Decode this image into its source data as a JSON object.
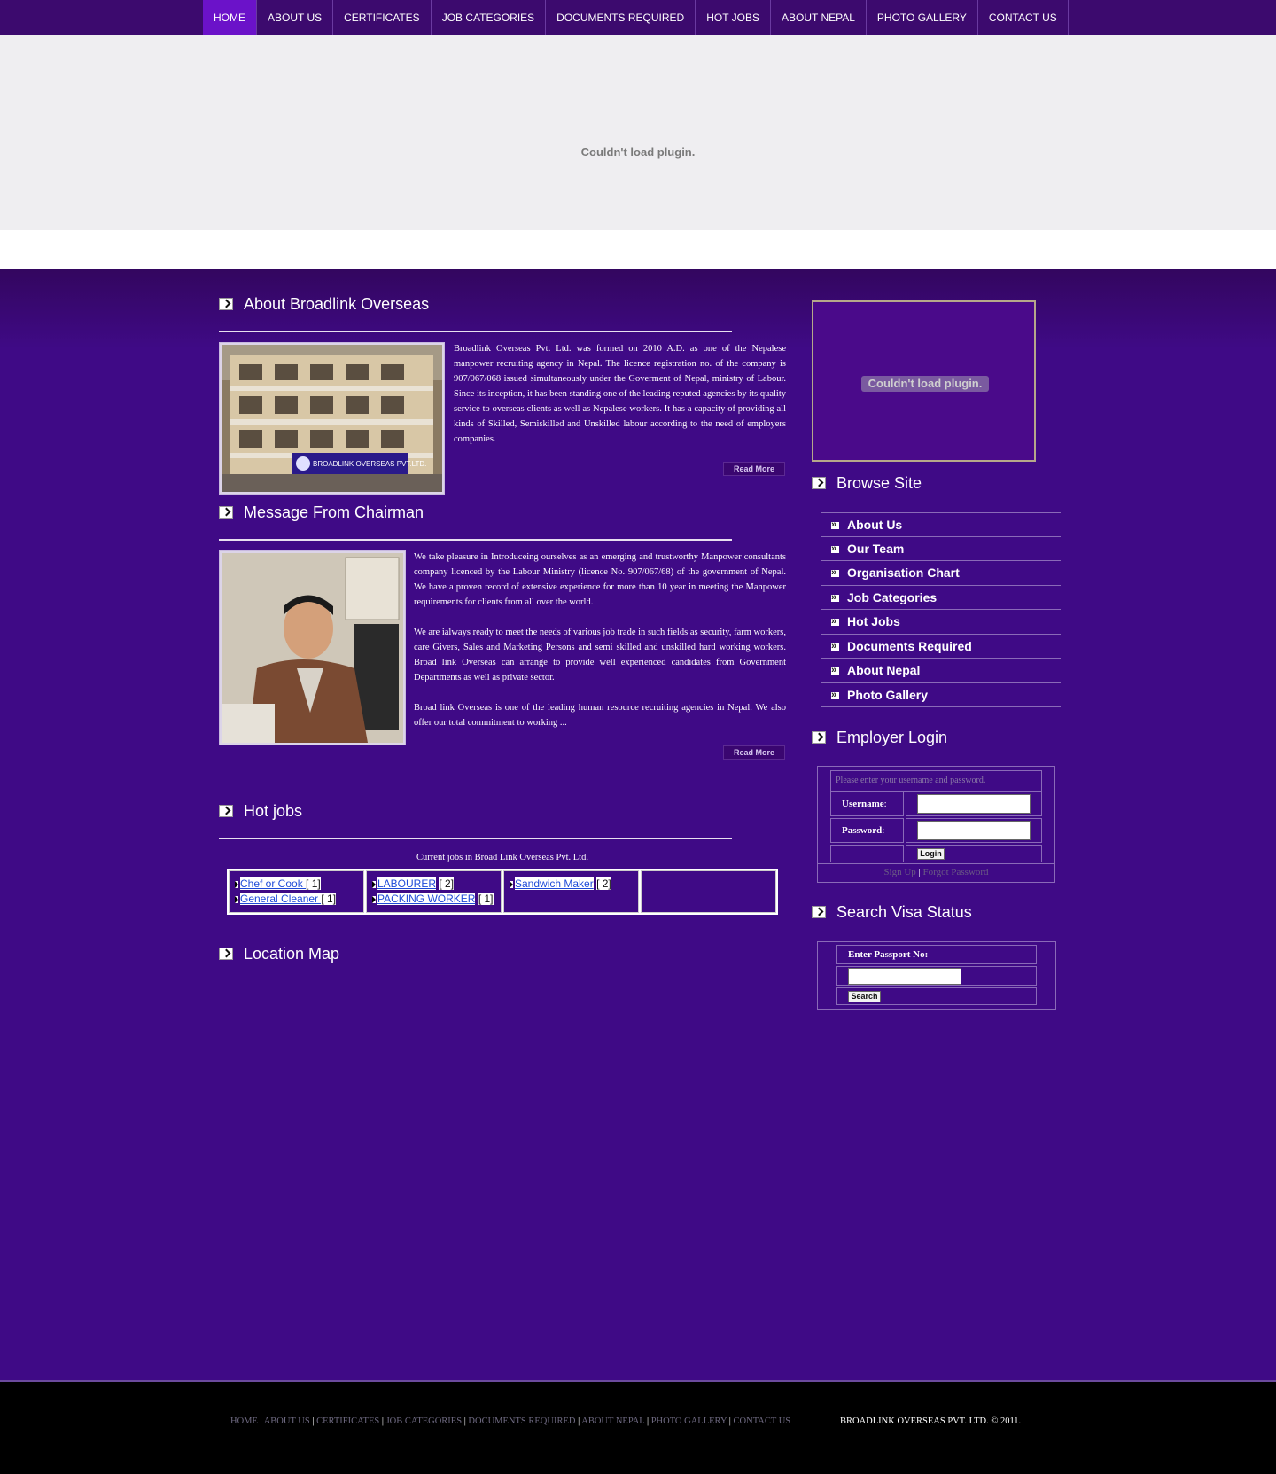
{
  "nav": {
    "items": [
      "HOME",
      "ABOUT US",
      "CERTIFICATES",
      "JOB CATEGORIES",
      "DOCUMENTS REQUIRED",
      "HOT JOBS",
      "ABOUT NEPAL",
      "PHOTO GALLERY",
      "CONTACT US"
    ],
    "active": "HOME"
  },
  "banner": {
    "plugin_message": "Couldn't load plugin."
  },
  "about": {
    "title": "About Broadlink Overseas",
    "text": "Broadlink Overseas Pvt. Ltd. was formed on 2010 A.D. as one of the Nepalese manpower recruiting agency in Nepal. The licence registration no. of the company is 907/067/068 issued simultaneously under the Goverment of Nepal, ministry of Labour. Since its inception, it has been standing one of the leading reputed agencies by its quality service to overseas clients as well as Nepalese workers. It has a capacity of providing all kinds of Skilled, Semiskilled and Unskilled labour according to the need of employers companies.",
    "read_more": "Read More",
    "photo_sign": "BROADLINK OVERSEAS PVT.LTD."
  },
  "chairman": {
    "title": "Message From Chairman",
    "paragraphs": [
      "We take pleasure in Introduceing ourselves as an emerging and trustworthy Manpower consultants company licenced by the Labour Ministry (licence No. 907/067/68) of the government of Nepal. We have a proven record of extensive experience for more than 10 year in meeting the Manpower requirements for clients from all over the world.",
      "We are ialways ready to meet the needs of various job trade in such fields as security, farm workers, care Givers, Sales and Marketing Persons and semi skilled and unskilled hard working workers. Broad link Overseas can arrange to provide well experienced candidates from Government Departments as well as private sector.",
      "Broad link Overseas is one of the leading human resource recruiting agencies in Nepal. We also offer our total commitment to working ..."
    ],
    "read_more": "Read More"
  },
  "hot_jobs": {
    "title": "Hot jobs",
    "caption": "Current jobs in Broad Link Overseas Pvt. Ltd.",
    "columns": [
      [
        {
          "name": "Chef or Cook ",
          "count": "[ 1]"
        },
        {
          "name": "General Cleaner ",
          "count": "[ 1]"
        }
      ],
      [
        {
          "name": "LABOURER",
          "count": "[ 2]"
        },
        {
          "name": "PACKING WORKER",
          "count": "[ 1]"
        }
      ],
      [
        {
          "name": "Sandwich Maker",
          "count": "[ 2]"
        }
      ],
      []
    ]
  },
  "location": {
    "title": "Location Map"
  },
  "sidebar": {
    "plugin_message": "Couldn't load plugin.",
    "browse_title": "Browse Site",
    "browse_items": [
      "About Us",
      "Our Team",
      "Organisation Chart",
      "Job Categories",
      "Hot Jobs",
      "Documents Required",
      "About Nepal",
      "Photo Gallery"
    ],
    "login_title": "Employer Login",
    "login_prompt": "Please enter your username and password.",
    "username_label": "Username",
    "password_label": "Password",
    "colon": ":",
    "login_button": "Login",
    "sign_up": "Sign Up",
    "separator": "|",
    "forgot": "Forgot Password",
    "visa_title": "Search Visa Status",
    "passport_label": "Enter Passport No:",
    "search_button": "Search"
  },
  "footer": {
    "links": [
      "HOME",
      "ABOUT US",
      "CERTIFICATES",
      "JOB CATEGORIES",
      "DOCUMENTS REQUIRED",
      "ABOUT NEPAL",
      "PHOTO GALLERY",
      "CONTACT US"
    ],
    "separator": "|",
    "copyright": "BROADLINK OVERSEAS PVT. LTD. © 2011."
  }
}
